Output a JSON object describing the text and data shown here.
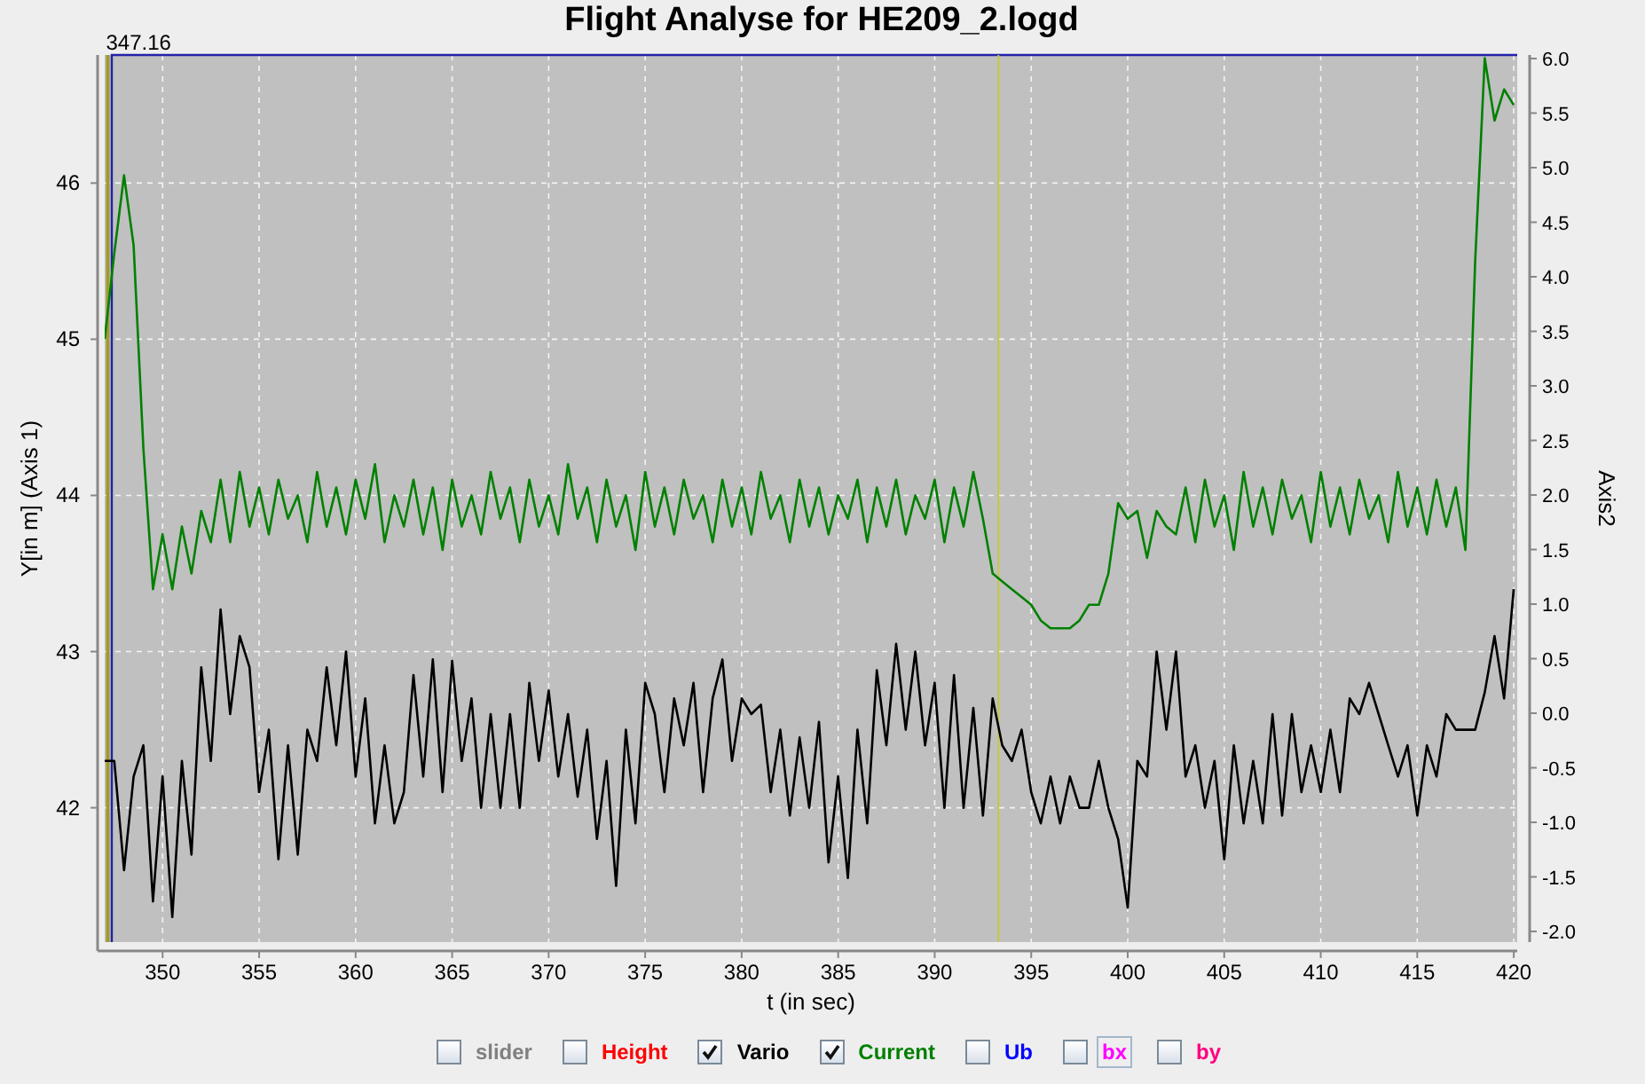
{
  "chart_data": {
    "type": "line",
    "title": "Flight Analyse for HE209_2.logd",
    "xlabel": "t (in sec)",
    "ylabel": "Y[in m] (Axis 1)",
    "grid": true,
    "xlim": [
      347.0,
      420.18
    ],
    "ylim": [
      41.14,
      46.82
    ],
    "xticks": [
      350,
      355,
      360,
      365,
      370,
      375,
      380,
      385,
      390,
      395,
      400,
      405,
      410,
      415,
      420
    ],
    "yticks": [
      42,
      43,
      44,
      45,
      46
    ],
    "x": [
      347,
      347.5,
      348,
      348.5,
      349,
      349.5,
      350,
      350.5,
      351,
      351.5,
      352,
      352.5,
      353,
      353.5,
      354,
      354.5,
      355,
      355.5,
      356,
      356.5,
      357,
      357.5,
      358,
      358.5,
      359,
      359.5,
      360,
      360.5,
      361,
      361.5,
      362,
      362.5,
      363,
      363.5,
      364,
      364.5,
      365,
      365.5,
      366,
      366.5,
      367,
      367.5,
      368,
      368.5,
      369,
      369.5,
      370,
      370.5,
      371,
      371.5,
      372,
      372.5,
      373,
      373.5,
      374,
      374.5,
      375,
      375.5,
      376,
      376.5,
      377,
      377.5,
      378,
      378.5,
      379,
      379.5,
      380,
      380.5,
      381,
      381.5,
      382,
      382.5,
      383,
      383.5,
      384,
      384.5,
      385,
      385.5,
      386,
      386.5,
      387,
      387.5,
      388,
      388.5,
      389,
      389.5,
      390,
      390.5,
      391,
      391.5,
      392,
      392.5,
      393,
      393.5,
      394,
      394.5,
      395,
      395.5,
      396,
      396.5,
      397,
      397.5,
      398,
      398.5,
      399,
      399.5,
      400,
      400.5,
      401,
      401.5,
      402,
      402.5,
      403,
      403.5,
      404,
      404.5,
      405,
      405.5,
      406,
      406.5,
      407,
      407.5,
      408,
      408.5,
      409,
      409.5,
      410,
      410.5,
      411,
      411.5,
      412,
      412.5,
      413,
      413.5,
      414,
      414.5,
      415,
      415.5,
      416,
      416.5,
      417,
      417.5,
      418,
      418.5,
      419,
      419.5,
      420
    ],
    "series": [
      {
        "name": "Vario",
        "color": "#000000",
        "values": [
          42.3,
          42.3,
          41.6,
          42.2,
          42.4,
          41.4,
          42.2,
          41.3,
          42.3,
          41.7,
          42.9,
          42.3,
          43.27,
          42.6,
          43.1,
          42.9,
          42.1,
          42.5,
          41.67,
          42.4,
          41.7,
          42.5,
          42.3,
          42.9,
          42.4,
          43.0,
          42.2,
          42.7,
          41.9,
          42.4,
          41.9,
          42.1,
          42.85,
          42.2,
          42.95,
          42.1,
          42.94,
          42.3,
          42.7,
          42.0,
          42.6,
          42.0,
          42.6,
          42.0,
          42.8,
          42.3,
          42.75,
          42.2,
          42.6,
          42.07,
          42.5,
          41.8,
          42.3,
          41.5,
          42.5,
          41.9,
          42.8,
          42.6,
          42.1,
          42.7,
          42.4,
          42.8,
          42.1,
          42.7,
          42.95,
          42.3,
          42.7,
          42.6,
          42.66,
          42.1,
          42.5,
          41.95,
          42.45,
          42.0,
          42.55,
          41.65,
          42.2,
          41.55,
          42.5,
          41.9,
          42.88,
          42.4,
          43.05,
          42.5,
          43.0,
          42.4,
          42.8,
          42.0,
          42.85,
          42.0,
          42.64,
          41.95,
          42.7,
          42.4,
          42.3,
          42.5,
          42.1,
          41.9,
          42.2,
          41.9,
          42.2,
          42.0,
          42.0,
          42.3,
          42.0,
          41.8,
          41.36,
          42.3,
          42.2,
          43.0,
          42.5,
          43.0,
          42.2,
          42.4,
          42.0,
          42.3,
          41.67,
          42.4,
          41.9,
          42.3,
          41.9,
          42.6,
          41.95,
          42.6,
          42.1,
          42.4,
          42.1,
          42.5,
          42.1,
          42.7,
          42.6,
          42.8,
          42.6,
          42.4,
          42.2,
          42.4,
          41.95,
          42.4,
          42.2,
          42.6,
          42.5,
          42.5,
          42.5,
          42.74,
          43.1,
          42.7,
          43.4
        ]
      },
      {
        "name": "Current",
        "color": "#008000",
        "values": [
          45.0,
          45.55,
          46.05,
          45.6,
          44.3,
          43.4,
          43.75,
          43.4,
          43.8,
          43.5,
          43.9,
          43.7,
          44.1,
          43.7,
          44.15,
          43.8,
          44.05,
          43.75,
          44.1,
          43.85,
          44.0,
          43.7,
          44.15,
          43.8,
          44.05,
          43.75,
          44.1,
          43.85,
          44.2,
          43.7,
          44.0,
          43.8,
          44.1,
          43.75,
          44.05,
          43.65,
          44.1,
          43.8,
          44.0,
          43.75,
          44.15,
          43.85,
          44.05,
          43.7,
          44.1,
          43.8,
          44.0,
          43.75,
          44.2,
          43.85,
          44.05,
          43.7,
          44.1,
          43.8,
          44.0,
          43.65,
          44.15,
          43.8,
          44.05,
          43.75,
          44.1,
          43.85,
          44.0,
          43.7,
          44.1,
          43.8,
          44.05,
          43.75,
          44.15,
          43.85,
          44.0,
          43.7,
          44.1,
          43.8,
          44.05,
          43.75,
          44.0,
          43.85,
          44.1,
          43.7,
          44.05,
          43.8,
          44.1,
          43.75,
          44.0,
          43.85,
          44.1,
          43.7,
          44.05,
          43.8,
          44.15,
          43.85,
          43.5,
          43.45,
          43.4,
          43.35,
          43.3,
          43.2,
          43.15,
          43.15,
          43.15,
          43.2,
          43.3,
          43.3,
          43.5,
          43.95,
          43.85,
          43.9,
          43.6,
          43.9,
          43.8,
          43.75,
          44.05,
          43.7,
          44.1,
          43.8,
          44.0,
          43.65,
          44.15,
          43.8,
          44.05,
          43.75,
          44.1,
          43.85,
          44.0,
          43.7,
          44.15,
          43.8,
          44.05,
          43.75,
          44.1,
          43.85,
          44.0,
          43.7,
          44.15,
          43.8,
          44.05,
          43.75,
          44.1,
          43.8,
          44.05,
          43.65,
          45.5,
          46.8,
          46.4,
          46.6,
          46.5
        ]
      }
    ],
    "ref_lines": [
      {
        "axis": "x",
        "value": 347.16,
        "label": "347.16"
      },
      {
        "axis": "x",
        "value": 393.3
      }
    ]
  },
  "right_axis": {
    "label": "Axis2",
    "ticks": [
      "6.0",
      "5.5",
      "5.0",
      "4.5",
      "4.0",
      "3.5",
      "3.0",
      "2.5",
      "2.0",
      "1.5",
      "1.0",
      "0.5",
      "0.0",
      "-0.5",
      "-1.0",
      "-1.5",
      "-2.0"
    ]
  },
  "legend": [
    {
      "label": "slider",
      "checked": false,
      "color": "#808080",
      "focused": false
    },
    {
      "label": "Height",
      "checked": false,
      "color": "#ff0000",
      "focused": false
    },
    {
      "kind": "series",
      "checked": true,
      "focused": false
    },
    {
      "kind": "series",
      "checked": true,
      "focused": false
    },
    {
      "label": "Ub",
      "checked": false,
      "color": "#0000ff",
      "focused": false
    },
    {
      "label": "bx",
      "checked": false,
      "color": "#ff00ff",
      "focused": true
    },
    {
      "label": "by",
      "checked": false,
      "color": "#ff0080",
      "focused": false
    }
  ]
}
